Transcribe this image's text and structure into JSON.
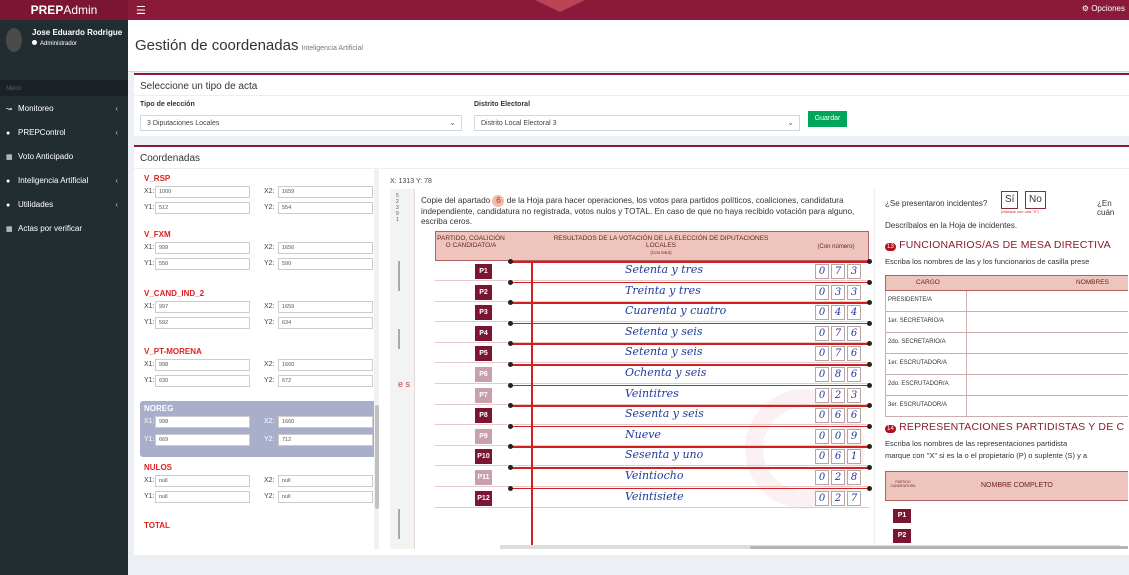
{
  "app": {
    "brand_bold": "PREP",
    "brand_rest": "Admin",
    "options_label": "Opciones"
  },
  "user": {
    "name": "Jose Eduardo Rodriguez",
    "role": "Administrador"
  },
  "sidebar": {
    "menu_header": "Menú",
    "items": [
      {
        "label": "Monitoreo",
        "icon": "chart-icon",
        "has_children": true
      },
      {
        "label": "PREPControl",
        "icon": "users-icon",
        "has_children": true
      },
      {
        "label": "Voto Anticipado",
        "icon": "list-icon",
        "has_children": false
      },
      {
        "label": "Inteligencia Artificial",
        "icon": "users-icon",
        "has_children": true
      },
      {
        "label": "Utilidades",
        "icon": "users-icon",
        "has_children": true
      },
      {
        "label": "Actas por verificar",
        "icon": "list-icon",
        "has_children": false
      }
    ]
  },
  "header": {
    "title": "Gestión de coordenadas",
    "subtitle": "Inteligencia Artificial"
  },
  "acta_box": {
    "title": "Seleccione un tipo de acta",
    "tipo_label": "Tipo de elección",
    "tipo_value": "3 Diputaciones Locales",
    "distrito_label": "Distrito Electoral",
    "distrito_value": "Distrito Local Electoral 3",
    "save_label": "Guardar"
  },
  "coords_box": {
    "title": "Coordenadas",
    "readout": "X: 1313 Y: 78",
    "groups": [
      {
        "name": "V_RSP",
        "x1": "1000",
        "x2": "1659",
        "y1": "512",
        "y2": "554"
      },
      {
        "name": "V_FXM",
        "x1": "999",
        "x2": "1656",
        "y1": "550",
        "y2": "590"
      },
      {
        "name": "V_CAND_IND_2",
        "x1": "997",
        "x2": "1659",
        "y1": "592",
        "y2": "634"
      },
      {
        "name": "V_PT-MORENA",
        "x1": "998",
        "x2": "1660",
        "y1": "630",
        "y2": "672"
      },
      {
        "name": "NOREG",
        "x1": "998",
        "x2": "1660",
        "y1": "669",
        "y2": "712"
      },
      {
        "name": "NULOS",
        "x1": "null",
        "x2": "null",
        "y1": "null",
        "y2": "null"
      },
      {
        "name": "TOTAL"
      }
    ],
    "labels": {
      "x1": "X1:",
      "x2": "X2:",
      "y1": "Y1:",
      "y2": "Y2:"
    }
  },
  "document": {
    "left_vertical_text": "5 2 3 9 1",
    "left_letters": "e s",
    "instruction_pre": "Copie del apartado",
    "instruction_num": "6",
    "instruction_post": "de la Hoja para hacer operaciones, los votos para partidos políticos, coaliciones, candidatura independiente, candidatura no registrada, votos nulos y TOTAL. En caso de que no haya recibido votación para alguno, escriba ceros.",
    "col_party": "PARTIDO, COALICIÓN O CANDIDATO/A",
    "col_results": "RESULTADOS DE LA VOTACIÓN DE LA ELECCIÓN DE DIPUTACIONES LOCALES",
    "col_results_sub": "(Con letra)",
    "col_number": "(Con número)",
    "rows": [
      {
        "party": "P1",
        "text": "Setenta y tres",
        "d": [
          "0",
          "7",
          "3"
        ]
      },
      {
        "party": "P2",
        "text": "Treinta y tres",
        "d": [
          "0",
          "3",
          "3"
        ]
      },
      {
        "party": "P3",
        "text": "Cuarenta y cuatro",
        "d": [
          "0",
          "4",
          "4"
        ]
      },
      {
        "party": "P4",
        "text": "Setenta y seis",
        "d": [
          "0",
          "7",
          "6"
        ]
      },
      {
        "party": "P5",
        "text": "Setenta y seis",
        "d": [
          "0",
          "7",
          "6"
        ]
      },
      {
        "party": "P6",
        "text": "Ochenta y seis",
        "d": [
          "0",
          "8",
          "6"
        ]
      },
      {
        "party": "P7",
        "text": "Veintitres",
        "d": [
          "0",
          "2",
          "3"
        ]
      },
      {
        "party": "P8",
        "text": "Sesenta y seis",
        "d": [
          "0",
          "6",
          "6"
        ]
      },
      {
        "party": "P9",
        "text": "Nueve",
        "d": [
          "0",
          "0",
          "9"
        ]
      },
      {
        "party": "P10",
        "text": "Sesenta y uno",
        "d": [
          "0",
          "6",
          "1"
        ]
      },
      {
        "party": "P11",
        "text": "Veintiocho",
        "d": [
          "0",
          "2",
          "8"
        ]
      },
      {
        "party": "P12",
        "text": "Veintisiete",
        "d": [
          "0",
          "2",
          "7"
        ]
      }
    ],
    "right": {
      "q_incidentes": "¿Se presentaron incidentes?",
      "si": "Sí",
      "no": "No",
      "si_note": "(Marque con una \"X\")",
      "q_cuantos": "¿En cuán",
      "describe": "Descríbalos en la Hoja de incidentes.",
      "sec13_num": "13",
      "sec13_title": "FUNCIONARIOS/AS DE MESA DIRECTIVA",
      "sec13_sub": "Escriba los nombres de las y los funcionarios de casilla prese",
      "cargo_head": "CARGO",
      "nombres_head": "NOMBRES",
      "cargos": [
        "PRESIDENTE/A",
        "1er. SECRETARIO/A",
        "2do. SECRETARIO/A",
        "1er. ESCRUTADOR/A",
        "2do. ESCRUTADOR/A",
        "3er. ESCRUTADOR/A"
      ],
      "sec14_num": "14",
      "sec14_title": "REPRESENTACIONES PARTIDISTAS Y DE C",
      "sec14_sub1": "Escriba los nombres de las representaciones partidista",
      "sec14_sub2": "marque con \"X\" si es la o el propietario (P) o suplente (S) y a",
      "pc_head_party": "PARTIDO CANDIDATURA",
      "pc_head_name": "NOMBRE COMPLETO",
      "parties": [
        "P1",
        "P2"
      ]
    }
  }
}
